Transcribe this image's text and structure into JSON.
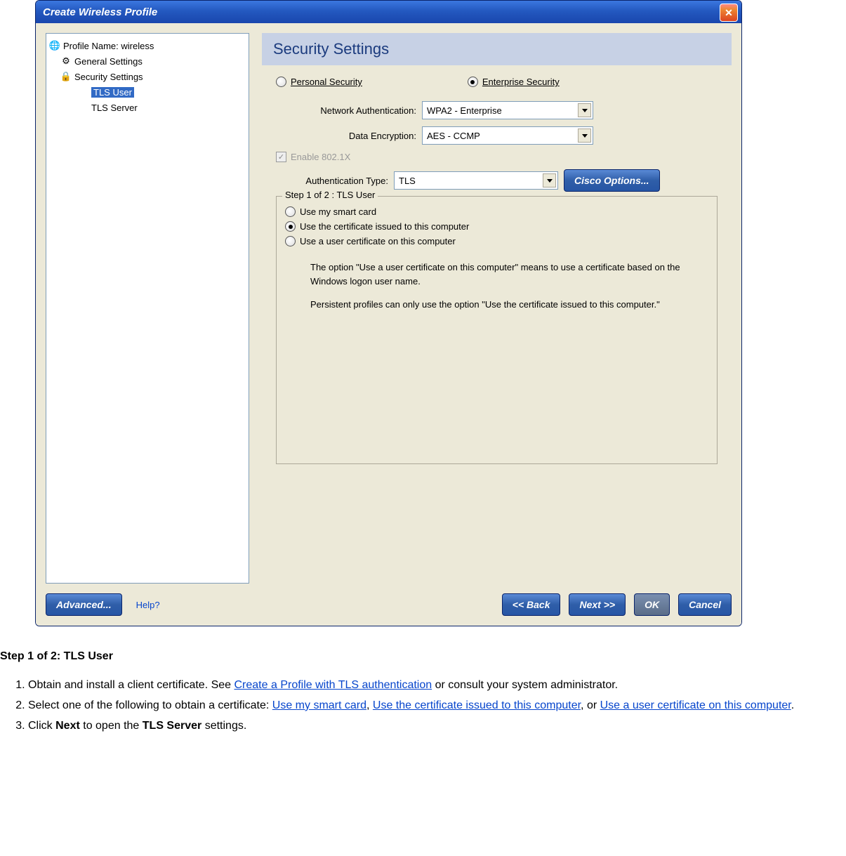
{
  "window": {
    "title": "Create Wireless Profile",
    "section_header": "Security Settings"
  },
  "tree": {
    "profile": "Profile Name: wireless",
    "general": "General Settings",
    "security": "Security Settings",
    "tls_user": "TLS User",
    "tls_server": "TLS Server"
  },
  "radios": {
    "personal": "Personal Security",
    "enterprise": "Enterprise Security"
  },
  "labels": {
    "net_auth": "Network Authentication:",
    "data_enc": "Data Encryption:",
    "enable_8021x": "Enable 802.1X",
    "auth_type": "Authentication Type:"
  },
  "values": {
    "net_auth": "WPA2 - Enterprise",
    "data_enc": "AES - CCMP",
    "auth_type": "TLS"
  },
  "buttons": {
    "cisco": "Cisco Options...",
    "advanced": "Advanced...",
    "help": "Help?",
    "back": "<< Back",
    "next": "Next >>",
    "ok": "OK",
    "cancel": "Cancel"
  },
  "fieldset": {
    "legend": "Step 1 of 2 : TLS User",
    "opt_smart": "Use my smart card",
    "opt_issued": "Use the certificate issued to this computer",
    "opt_usercert": "Use a user certificate on this computer",
    "explain1": "The option \"Use a user certificate on this computer\" means to use a certificate based on the Windows logon user name.",
    "explain2": "Persistent profiles can only use the option \"Use the certificate issued to this computer.\""
  },
  "doc": {
    "heading": "Step 1 of 2: TLS User",
    "step1_a": "Obtain and install a client certificate. See ",
    "step1_link": "Create a Profile with TLS authentication",
    "step1_b": " or consult your system administrator.",
    "step2_a": "Select one of the following to obtain a certificate: ",
    "step2_l1": "Use my smart card",
    "step2_l2": "Use the certificate issued to this computer",
    "step2_l3": "Use a user certificate on this computer",
    "step3_a": "Click ",
    "step3_b": "Next",
    "step3_c": " to open the ",
    "step3_d": "TLS Server",
    "step3_e": " settings."
  }
}
